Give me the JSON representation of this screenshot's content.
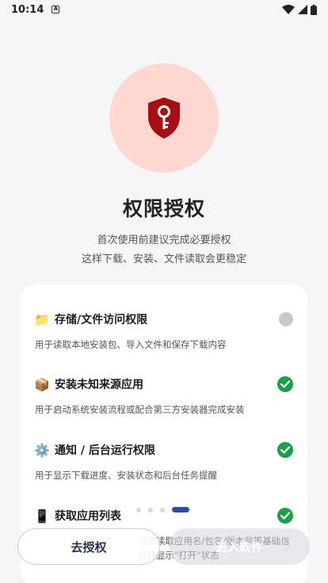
{
  "status_bar": {
    "time": "10:14",
    "notification_glyph": "A"
  },
  "hero": {
    "icon": "shield-key-icon",
    "color": "#a50f14",
    "bg": "#ffd8d4"
  },
  "title": "权限授权",
  "subtitle": [
    "首次使用前建议完成必要授权",
    "这样下载、安装、文件读取会更稳定"
  ],
  "permissions": [
    {
      "icon": "📁",
      "title": "存储/文件访问权限",
      "desc": "用于读取本地安装包、导入文件和保存下载内容",
      "status": "pending"
    },
    {
      "icon": "📦",
      "title": "安装未知来源应用",
      "desc": "用于启动系统安装流程或配合第三方安装器完成安装",
      "status": "granted"
    },
    {
      "icon": "⚙️",
      "title": "通知 / 后台运行权限",
      "desc": "用于显示下载进度、安装状态和后台任务提醒",
      "status": "granted"
    },
    {
      "icon": "📱",
      "title": "获取应用列表",
      "desc": "用于读取应用名/包名/版本号等基础信",
      "desc2": "装后显示\"打开\"状态",
      "status": "granted"
    }
  ],
  "pager": {
    "count": 4,
    "active": 3
  },
  "buttons": {
    "authorize": "去授权",
    "enter": "进入软件"
  },
  "colors": {
    "accent": "#2a4fa0",
    "success": "#1e9e4b",
    "pending": "#c7c9cf"
  }
}
